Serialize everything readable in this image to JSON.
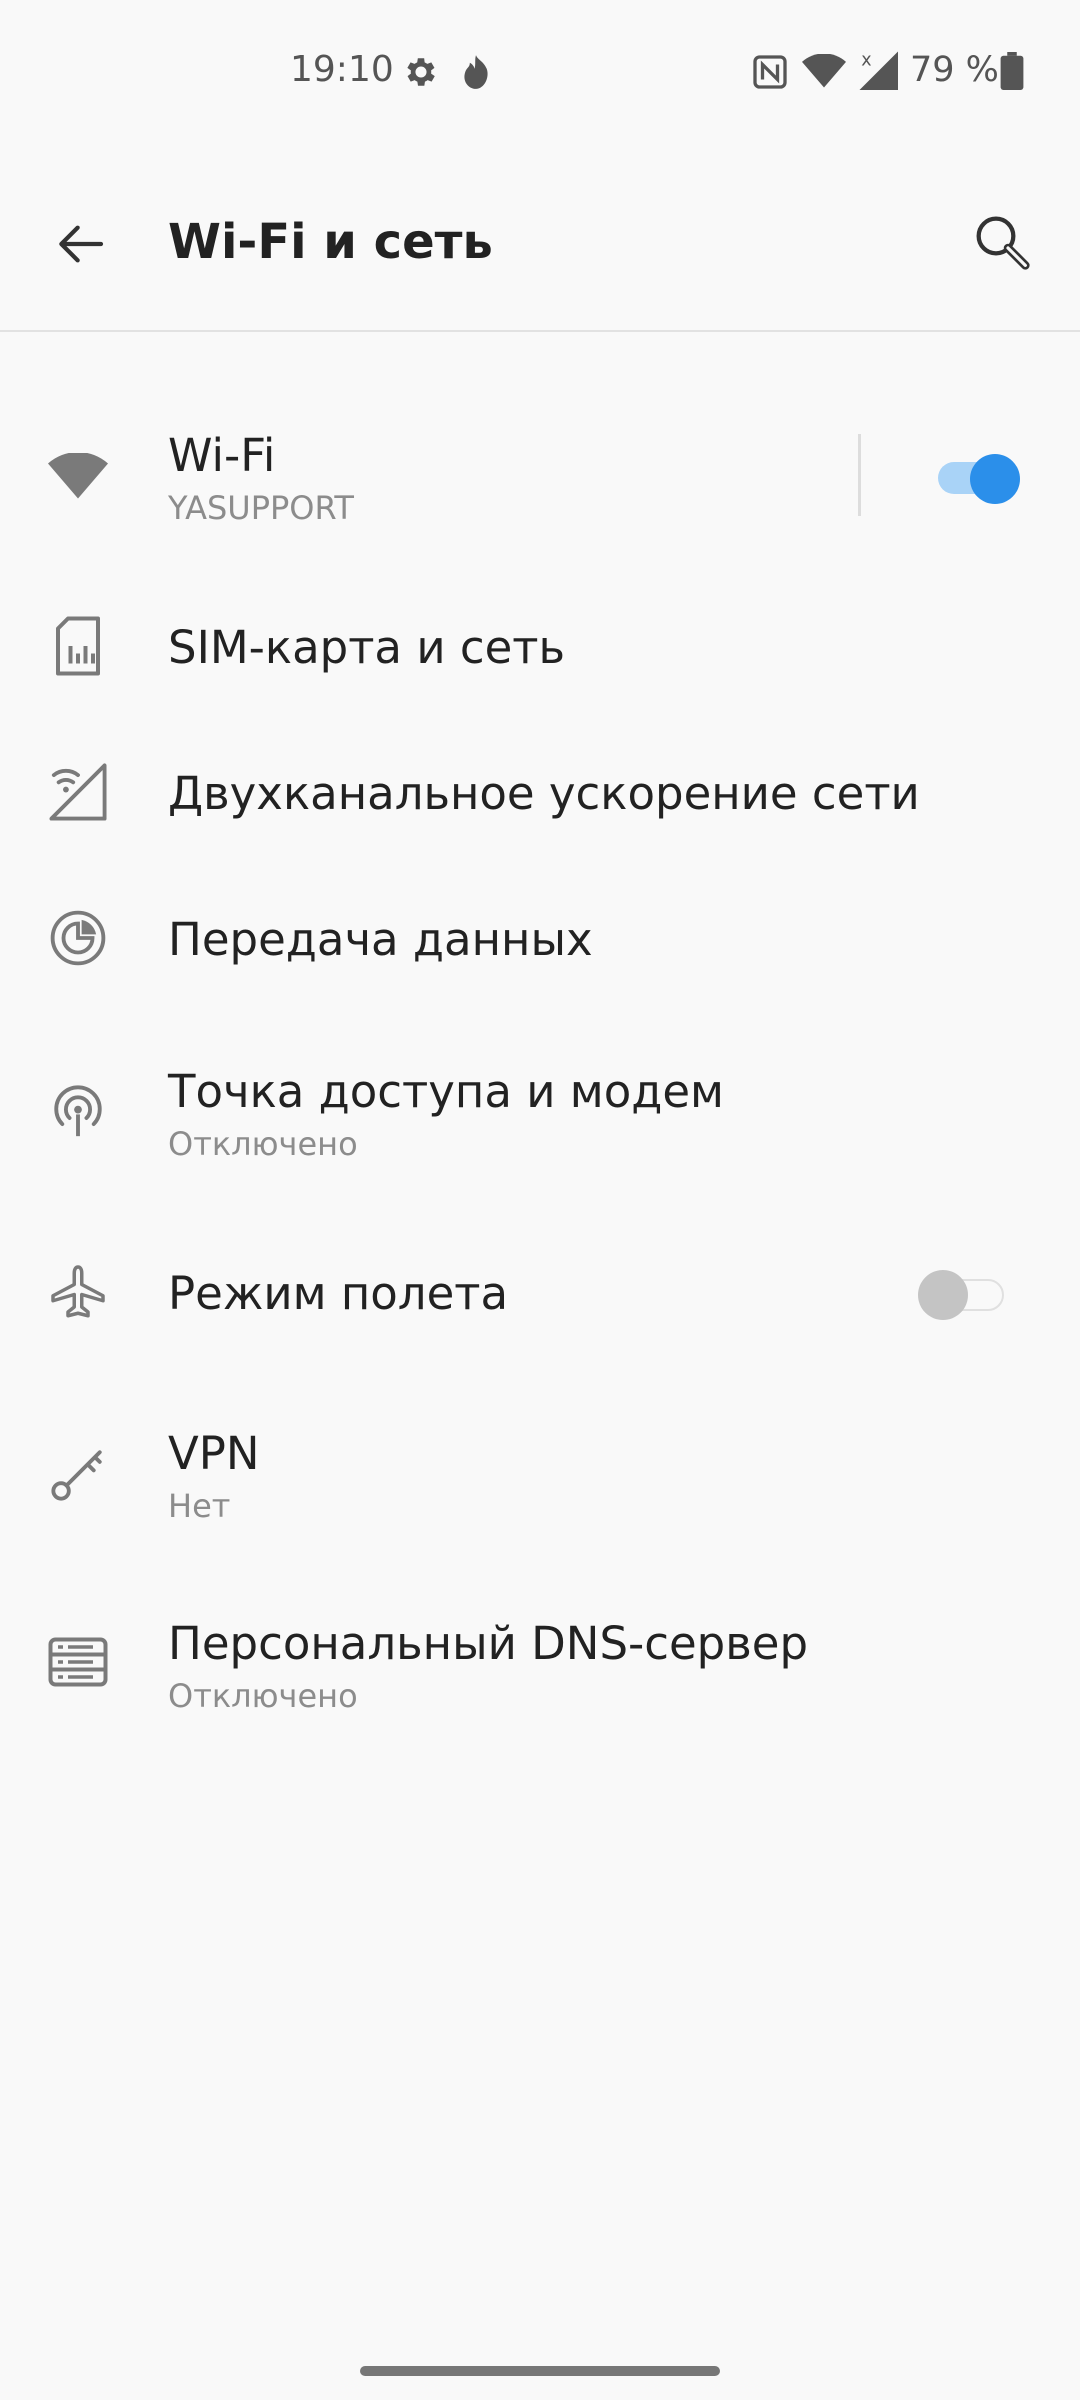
{
  "status_bar": {
    "time": "19:10",
    "battery": "79 %",
    "icons": [
      "settings-gear-icon",
      "app-notification-icon",
      "nfc-icon",
      "wifi-signal-icon",
      "cellular-no-data-icon",
      "battery-icon"
    ]
  },
  "app_bar": {
    "title": "Wi-Fi и сеть",
    "back_icon": "arrow-left-icon",
    "search_icon": "search-icon"
  },
  "items": [
    {
      "title": "Wi-Fi",
      "subtitle": "YASUPPORT",
      "icon": "wifi-icon",
      "toggle": true
    },
    {
      "title": "SIM-карта и сеть",
      "icon": "sim-card-icon"
    },
    {
      "title": "Двухканальное ускорение сети",
      "icon": "dual-channel-icon"
    },
    {
      "title": "Передача данных",
      "icon": "data-usage-icon"
    },
    {
      "title": "Точка доступа и модем",
      "subtitle": "Отключено",
      "icon": "hotspot-icon"
    },
    {
      "title": "Режим полета",
      "icon": "airplane-icon",
      "toggle": false
    },
    {
      "title": "VPN",
      "subtitle": "Нет",
      "icon": "key-icon"
    },
    {
      "title": "Персональный DNS-сервер",
      "subtitle": "Отключено",
      "icon": "dns-server-icon"
    }
  ],
  "colors": {
    "accent": "#2b8fea",
    "accent_track": "#a9d3f7",
    "icon_gray": "#7a7a7a",
    "background": "#f9f9f9"
  }
}
